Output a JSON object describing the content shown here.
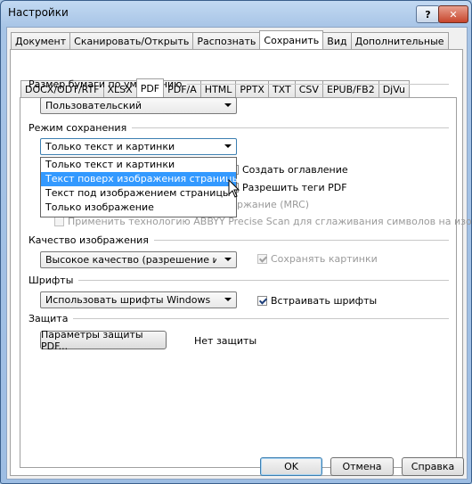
{
  "window": {
    "title": "Настройки",
    "help_label": "?",
    "close_label": "✕"
  },
  "main_tabs": [
    {
      "label": "Документ",
      "active": false
    },
    {
      "label": "Сканировать/Открыть",
      "active": false
    },
    {
      "label": "Распознать",
      "active": false
    },
    {
      "label": "Сохранить",
      "active": true
    },
    {
      "label": "Вид",
      "active": false
    },
    {
      "label": "Дополнительные",
      "active": false
    }
  ],
  "format_tabs": [
    {
      "label": "DOCX/ODT/RTF",
      "active": false
    },
    {
      "label": "XLSX",
      "active": false
    },
    {
      "label": "PDF",
      "active": true
    },
    {
      "label": "PDF/A",
      "active": false
    },
    {
      "label": "HTML",
      "active": false
    },
    {
      "label": "PPTX",
      "active": false
    },
    {
      "label": "TXT",
      "active": false
    },
    {
      "label": "CSV",
      "active": false
    },
    {
      "label": "EPUB/FB2",
      "active": false
    },
    {
      "label": "DjVu",
      "active": false
    }
  ],
  "paper": {
    "label": "Размер бумаги по умолчанию",
    "value": "Пользовательский"
  },
  "save_mode": {
    "label": "Режим сохранения",
    "value": "Только текст и картинки",
    "options": [
      "Только текст и картинки",
      "Текст поверх изображения страницы",
      "Текст под изображением страницы",
      "Только изображение"
    ],
    "highlighted_index": 1
  },
  "checkboxes_mode": {
    "toc": "Создать оглавление",
    "tags": "Разрешить теги PDF",
    "mrc_partial": "ржание (MRC)",
    "precise_scan": "Применить технологию ABBYY Precise Scan для сглаживания символов на изображениях"
  },
  "quality": {
    "label": "Качество изображения",
    "value": "Высокое качество (разрешение исходно",
    "keep_images": "Сохранять картинки"
  },
  "fonts": {
    "label": "Шрифты",
    "value": "Использовать шрифты Windows",
    "embed": "Встраивать шрифты"
  },
  "protection": {
    "label": "Защита",
    "button": "Параметры защиты PDF...",
    "status": "Нет защиты"
  },
  "footer": {
    "ok": "OK",
    "cancel": "Отмена",
    "help": "Справка"
  }
}
